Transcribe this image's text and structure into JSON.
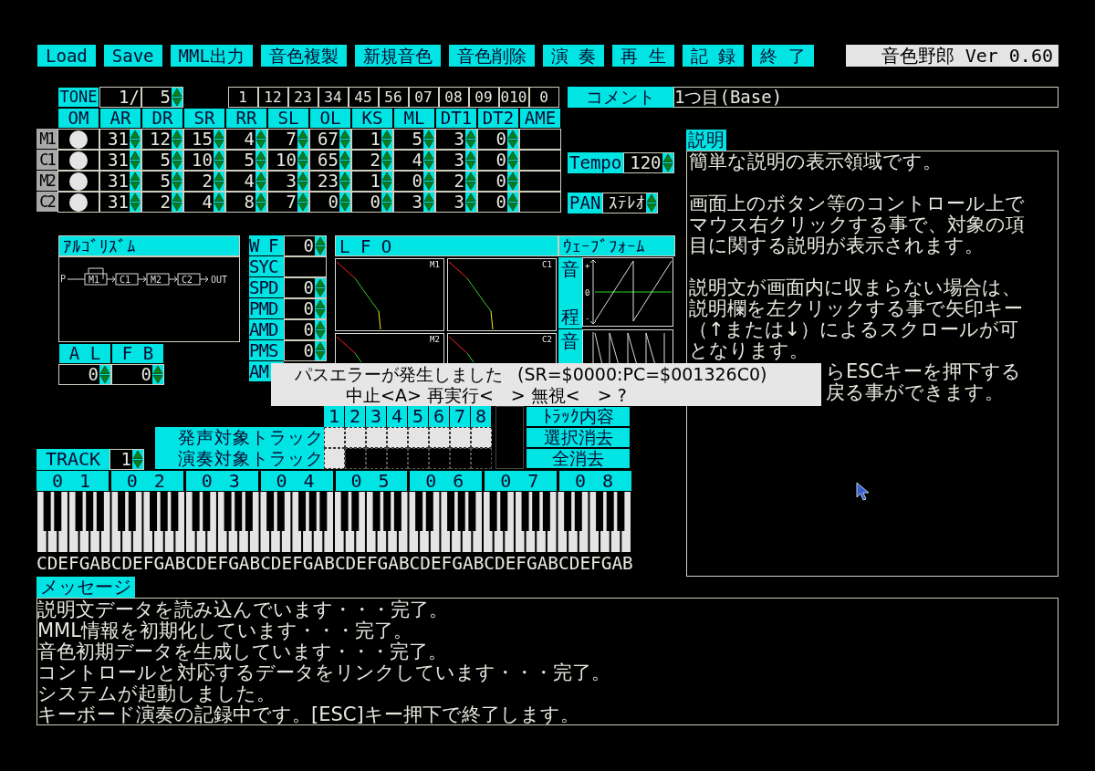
{
  "toolbar": {
    "buttons": [
      "Load",
      "Save",
      "MML出力",
      "音色複製",
      "新規音色",
      "音色削除",
      "演 奏",
      "再 生",
      "記 録",
      "終 了"
    ],
    "title": "音色野郎 Ver 0.60"
  },
  "tone": {
    "label": "TONE",
    "current": "1/",
    "total": "5",
    "slots": [
      "1",
      "12",
      "23",
      "34",
      "45",
      "56",
      "07",
      "08",
      "09",
      "010",
      "0"
    ],
    "columns": [
      "OM",
      "AR",
      "DR",
      "SR",
      "RR",
      "SL",
      "OL",
      "KS",
      "ML",
      "DT1",
      "DT2",
      "AME"
    ],
    "operators": [
      {
        "name": "M1",
        "enabled": true,
        "values": [
          "31",
          "12",
          "15",
          "4",
          "7",
          "67",
          "1",
          "5",
          "3",
          "0"
        ]
      },
      {
        "name": "C1",
        "enabled": true,
        "values": [
          "31",
          "5",
          "10",
          "5",
          "10",
          "65",
          "2",
          "4",
          "3",
          "0"
        ]
      },
      {
        "name": "M2",
        "enabled": true,
        "values": [
          "31",
          "5",
          "2",
          "4",
          "3",
          "23",
          "1",
          "0",
          "2",
          "0"
        ]
      },
      {
        "name": "C2",
        "enabled": true,
        "values": [
          "31",
          "2",
          "4",
          "8",
          "7",
          "0",
          "0",
          "3",
          "3",
          "0"
        ]
      }
    ]
  },
  "comment": {
    "label": "コメント",
    "value": "1つ目(Base)"
  },
  "tempo": {
    "label": "Tempo",
    "value": "120"
  },
  "pan": {
    "label": "PAN",
    "value": "ｽﾃﾚｵ"
  },
  "description": {
    "label": "説明",
    "paragraphs": [
      [
        "簡単な説明の表示領域です。"
      ],
      [
        "画面上のボタン等のコントロール上で",
        "マウス右クリックする事で、対象の項",
        "目に関する説明が表示されます。"
      ],
      [
        "説明文が画面内に収まらない場合は、",
        "説明欄を左クリックする事で矢印キー",
        "（↑または↓）によるスクロールが可",
        "となります。"
      ]
    ],
    "covered_lines": [
      "らESCキーを押下する",
      "戻る事ができます。"
    ]
  },
  "algorithm": {
    "title": "ｱﾙｺﾞﾘｽﾞﾑ",
    "input": "P",
    "operators": [
      "M1",
      "C1",
      "M2",
      "C2"
    ],
    "output": "OUT",
    "al": {
      "label": "A L",
      "value": "0"
    },
    "fb": {
      "label": "F B",
      "value": "0"
    }
  },
  "lfo_params": [
    {
      "label": "W F",
      "kind": "spin",
      "value": "0"
    },
    {
      "label": "SYC",
      "kind": "blank"
    },
    {
      "label": "SPD",
      "kind": "spin",
      "value": "0"
    },
    {
      "label": "PMD",
      "kind": "spin",
      "value": "0"
    },
    {
      "label": "AMD",
      "kind": "spin",
      "value": "0"
    },
    {
      "label": "PMS",
      "kind": "spin",
      "value": "0"
    },
    {
      "label": "AM",
      "kind": "covered"
    }
  ],
  "lfo": {
    "title": "L F O",
    "graphs": [
      "M1",
      "C1",
      "M2",
      "C2"
    ]
  },
  "waveform": {
    "title": "ｳｪｰﾌﾞﾌｫｰﾑ",
    "pitch_label": [
      "音",
      "程"
    ],
    "ticks": [
      "+",
      "0",
      "-"
    ],
    "volume_label": "音"
  },
  "dialog": {
    "message": "パスエラーが発生しました",
    "detail": "(SR=$0000:PC=$001326C0)",
    "prompt": "中止<A> 再実行<　> 無視<　> ?"
  },
  "tracks": {
    "numbers": [
      "1",
      "2",
      "3",
      "4",
      "5",
      "6",
      "7",
      "8"
    ],
    "voice": {
      "label": "発声対象トラック",
      "cells": [
        {
          "checked": true
        },
        {
          "checked": true
        },
        {
          "checked": true
        },
        {
          "checked": true
        },
        {
          "checked": true
        },
        {
          "checked": true
        },
        {
          "checked": true
        },
        {
          "checked": true
        }
      ]
    },
    "play": {
      "label": "演奏対象トラック",
      "cells": [
        {
          "checked": true
        },
        {
          "checked": false
        },
        {
          "checked": false
        },
        {
          "checked": false
        },
        {
          "checked": false
        },
        {
          "checked": false
        },
        {
          "checked": false
        },
        {
          "checked": false
        }
      ]
    },
    "buttons": [
      "ﾄﾗｯｸ内容",
      "選択消去",
      "全消去"
    ]
  },
  "track": {
    "label": "TRACK",
    "value": "1"
  },
  "octaves": [
    "0 1",
    "0 2",
    "0 3",
    "0 4",
    "0 5",
    "0 6",
    "0 7",
    "0 8"
  ],
  "note_names": "CDEFGABCDEFGABCDEFGABCDEFGABCDEFGABCDEFGABCDEFGABCDEFGAB",
  "messages": {
    "label": "メッセージ",
    "lines": [
      "説明文データを読み込んでいます・・・完了。",
      "MML情報を初期化しています・・・完了。",
      "音色初期データを生成しています・・・完了。",
      "コントロールと対応するデータをリンクしています・・・完了。",
      "システムが起動しました。",
      "キーボード演奏の記録中です。[ESC]キー押下で終了します。"
    ]
  }
}
